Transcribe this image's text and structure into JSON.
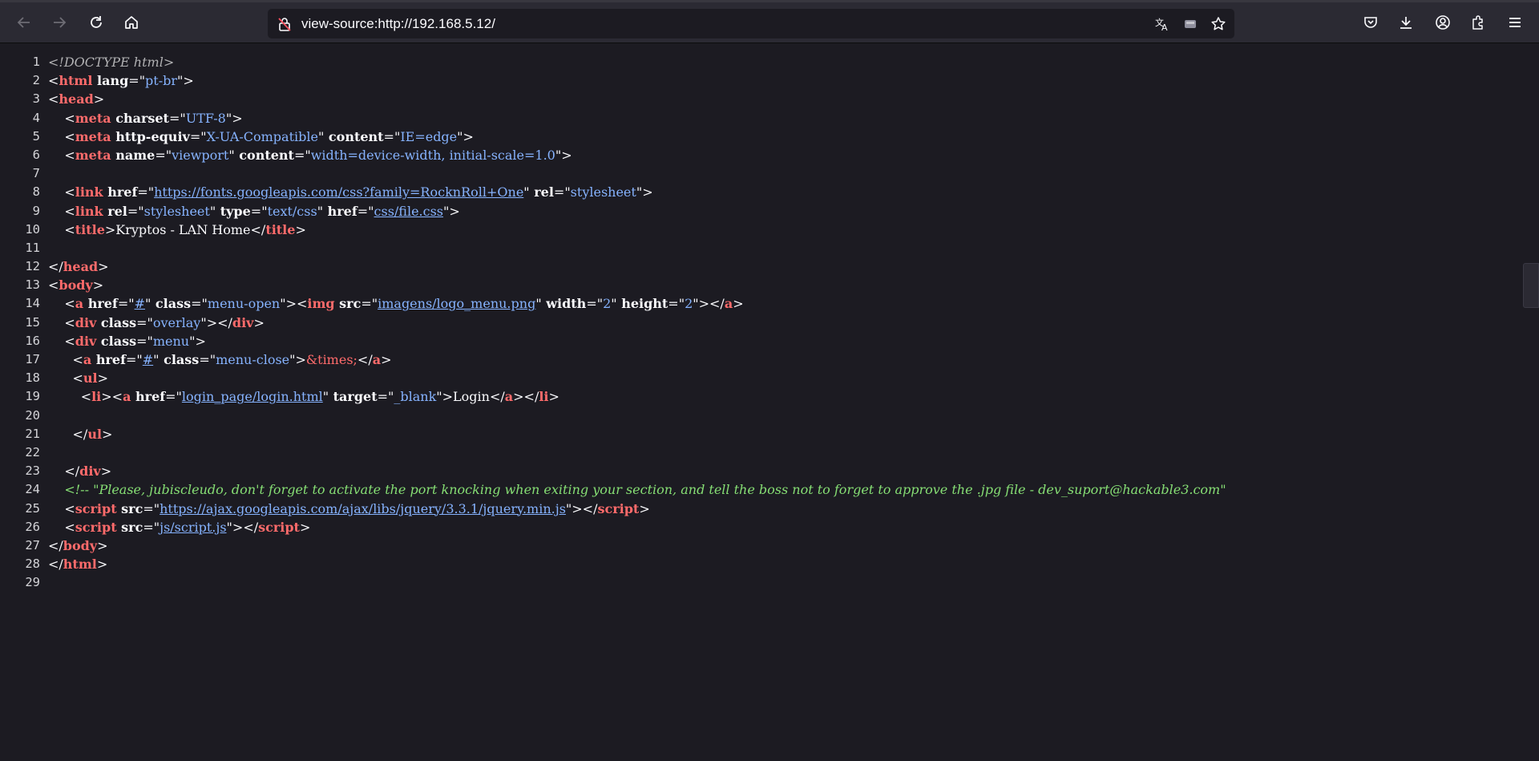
{
  "browser": {
    "url": "view-source:http://192.168.5.12/",
    "icons": [
      "back-icon",
      "forward-icon",
      "reload-icon",
      "home-icon",
      "not-secure-lock-icon",
      "translate-icon",
      "reader-icon",
      "bookmark-star-icon",
      "pocket-icon",
      "downloads-icon",
      "account-icon",
      "extensions-icon",
      "menu-icon"
    ]
  },
  "colors": {
    "background": "#1c1b22",
    "toolbar": "#2b2a33",
    "tag": "#ff6b6b",
    "attribute_value": "#86b3ff",
    "comment": "#86de74"
  },
  "source_lines": [
    {
      "n": "1",
      "segments": [
        {
          "c": "doctype",
          "t": "<!DOCTYPE html>"
        }
      ]
    },
    {
      "n": "2",
      "segments": [
        {
          "c": "br",
          "t": "<"
        },
        {
          "c": "tagname",
          "t": "html"
        },
        {
          "c": "attr",
          "t": " lang"
        },
        {
          "c": "br",
          "t": "=\""
        },
        {
          "c": "val",
          "t": "pt-br"
        },
        {
          "c": "br",
          "t": "\">"
        }
      ]
    },
    {
      "n": "3",
      "segments": [
        {
          "c": "br",
          "t": "<"
        },
        {
          "c": "tagname",
          "t": "head"
        },
        {
          "c": "br",
          "t": ">"
        }
      ]
    },
    {
      "n": "4",
      "segments": [
        {
          "c": "txt",
          "t": "    "
        },
        {
          "c": "br",
          "t": "<"
        },
        {
          "c": "tagname",
          "t": "meta"
        },
        {
          "c": "attr",
          "t": " charset"
        },
        {
          "c": "br",
          "t": "=\""
        },
        {
          "c": "val",
          "t": "UTF-8"
        },
        {
          "c": "br",
          "t": "\">"
        }
      ]
    },
    {
      "n": "5",
      "segments": [
        {
          "c": "txt",
          "t": "    "
        },
        {
          "c": "br",
          "t": "<"
        },
        {
          "c": "tagname",
          "t": "meta"
        },
        {
          "c": "attr",
          "t": " http-equiv"
        },
        {
          "c": "br",
          "t": "=\""
        },
        {
          "c": "val",
          "t": "X-UA-Compatible"
        },
        {
          "c": "br",
          "t": "\""
        },
        {
          "c": "attr",
          "t": " content"
        },
        {
          "c": "br",
          "t": "=\""
        },
        {
          "c": "val",
          "t": "IE=edge"
        },
        {
          "c": "br",
          "t": "\">"
        }
      ]
    },
    {
      "n": "6",
      "segments": [
        {
          "c": "txt",
          "t": "    "
        },
        {
          "c": "br",
          "t": "<"
        },
        {
          "c": "tagname",
          "t": "meta"
        },
        {
          "c": "attr",
          "t": " name"
        },
        {
          "c": "br",
          "t": "=\""
        },
        {
          "c": "val",
          "t": "viewport"
        },
        {
          "c": "br",
          "t": "\""
        },
        {
          "c": "attr",
          "t": " content"
        },
        {
          "c": "br",
          "t": "=\""
        },
        {
          "c": "val",
          "t": "width=device-width, initial-scale=1.0"
        },
        {
          "c": "br",
          "t": "\">"
        }
      ]
    },
    {
      "n": "7",
      "segments": []
    },
    {
      "n": "8",
      "segments": [
        {
          "c": "txt",
          "t": "    "
        },
        {
          "c": "br",
          "t": "<"
        },
        {
          "c": "tagname",
          "t": "link"
        },
        {
          "c": "attr",
          "t": " href"
        },
        {
          "c": "br",
          "t": "=\""
        },
        {
          "c": "link",
          "t": "https://fonts.googleapis.com/css?family=RocknRoll+One"
        },
        {
          "c": "br",
          "t": "\""
        },
        {
          "c": "attr",
          "t": " rel"
        },
        {
          "c": "br",
          "t": "=\""
        },
        {
          "c": "val",
          "t": "stylesheet"
        },
        {
          "c": "br",
          "t": "\">"
        }
      ]
    },
    {
      "n": "9",
      "segments": [
        {
          "c": "txt",
          "t": "    "
        },
        {
          "c": "br",
          "t": "<"
        },
        {
          "c": "tagname",
          "t": "link"
        },
        {
          "c": "attr",
          "t": " rel"
        },
        {
          "c": "br",
          "t": "=\""
        },
        {
          "c": "val",
          "t": "stylesheet"
        },
        {
          "c": "br",
          "t": "\""
        },
        {
          "c": "attr",
          "t": " type"
        },
        {
          "c": "br",
          "t": "=\""
        },
        {
          "c": "val",
          "t": "text/css"
        },
        {
          "c": "br",
          "t": "\""
        },
        {
          "c": "attr",
          "t": " href"
        },
        {
          "c": "br",
          "t": "=\""
        },
        {
          "c": "link",
          "t": "css/file.css"
        },
        {
          "c": "br",
          "t": "\">"
        }
      ]
    },
    {
      "n": "10",
      "segments": [
        {
          "c": "txt",
          "t": "    "
        },
        {
          "c": "br",
          "t": "<"
        },
        {
          "c": "tagname",
          "t": "title"
        },
        {
          "c": "br",
          "t": ">"
        },
        {
          "c": "txt",
          "t": "Kryptos - LAN Home"
        },
        {
          "c": "br",
          "t": "</"
        },
        {
          "c": "tagname",
          "t": "title"
        },
        {
          "c": "br",
          "t": ">"
        }
      ]
    },
    {
      "n": "11",
      "segments": []
    },
    {
      "n": "12",
      "segments": [
        {
          "c": "br",
          "t": "</"
        },
        {
          "c": "tagname",
          "t": "head"
        },
        {
          "c": "br",
          "t": ">"
        }
      ]
    },
    {
      "n": "13",
      "segments": [
        {
          "c": "br",
          "t": "<"
        },
        {
          "c": "tagname",
          "t": "body"
        },
        {
          "c": "br",
          "t": ">"
        }
      ]
    },
    {
      "n": "14",
      "segments": [
        {
          "c": "txt",
          "t": "    "
        },
        {
          "c": "br",
          "t": "<"
        },
        {
          "c": "tagname",
          "t": "a"
        },
        {
          "c": "attr",
          "t": " href"
        },
        {
          "c": "br",
          "t": "=\""
        },
        {
          "c": "link",
          "t": "#"
        },
        {
          "c": "br",
          "t": "\""
        },
        {
          "c": "attr",
          "t": " class"
        },
        {
          "c": "br",
          "t": "=\""
        },
        {
          "c": "val",
          "t": "menu-open"
        },
        {
          "c": "br",
          "t": "\"><"
        },
        {
          "c": "tagname",
          "t": "img"
        },
        {
          "c": "attr",
          "t": " src"
        },
        {
          "c": "br",
          "t": "=\""
        },
        {
          "c": "link",
          "t": "imagens/logo_menu.png"
        },
        {
          "c": "br",
          "t": "\""
        },
        {
          "c": "attr",
          "t": " width"
        },
        {
          "c": "br",
          "t": "=\""
        },
        {
          "c": "val",
          "t": "2"
        },
        {
          "c": "br",
          "t": "\""
        },
        {
          "c": "attr",
          "t": " height"
        },
        {
          "c": "br",
          "t": "=\""
        },
        {
          "c": "val",
          "t": "2"
        },
        {
          "c": "br",
          "t": "\"></"
        },
        {
          "c": "tagname",
          "t": "a"
        },
        {
          "c": "br",
          "t": ">"
        }
      ]
    },
    {
      "n": "15",
      "segments": [
        {
          "c": "txt",
          "t": "    "
        },
        {
          "c": "br",
          "t": "<"
        },
        {
          "c": "tagname",
          "t": "div"
        },
        {
          "c": "attr",
          "t": " class"
        },
        {
          "c": "br",
          "t": "=\""
        },
        {
          "c": "val",
          "t": "overlay"
        },
        {
          "c": "br",
          "t": "\"></"
        },
        {
          "c": "tagname",
          "t": "div"
        },
        {
          "c": "br",
          "t": ">"
        }
      ]
    },
    {
      "n": "16",
      "segments": [
        {
          "c": "txt",
          "t": "    "
        },
        {
          "c": "br",
          "t": "<"
        },
        {
          "c": "tagname",
          "t": "div"
        },
        {
          "c": "attr",
          "t": " class"
        },
        {
          "c": "br",
          "t": "=\""
        },
        {
          "c": "val",
          "t": "menu"
        },
        {
          "c": "br",
          "t": "\">"
        }
      ]
    },
    {
      "n": "17",
      "segments": [
        {
          "c": "txt",
          "t": "      "
        },
        {
          "c": "br",
          "t": "<"
        },
        {
          "c": "tagname",
          "t": "a"
        },
        {
          "c": "attr",
          "t": " href"
        },
        {
          "c": "br",
          "t": "=\""
        },
        {
          "c": "link",
          "t": "#"
        },
        {
          "c": "br",
          "t": "\""
        },
        {
          "c": "attr",
          "t": " class"
        },
        {
          "c": "br",
          "t": "=\""
        },
        {
          "c": "val",
          "t": "menu-close"
        },
        {
          "c": "br",
          "t": "\">"
        },
        {
          "c": "ent",
          "t": "&times;"
        },
        {
          "c": "br",
          "t": "</"
        },
        {
          "c": "tagname",
          "t": "a"
        },
        {
          "c": "br",
          "t": ">"
        }
      ]
    },
    {
      "n": "18",
      "segments": [
        {
          "c": "txt",
          "t": "      "
        },
        {
          "c": "br",
          "t": "<"
        },
        {
          "c": "tagname",
          "t": "ul"
        },
        {
          "c": "br",
          "t": ">"
        }
      ]
    },
    {
      "n": "19",
      "segments": [
        {
          "c": "txt",
          "t": "        "
        },
        {
          "c": "br",
          "t": "<"
        },
        {
          "c": "tagname",
          "t": "li"
        },
        {
          "c": "br",
          "t": "><"
        },
        {
          "c": "tagname",
          "t": "a"
        },
        {
          "c": "attr",
          "t": " href"
        },
        {
          "c": "br",
          "t": "=\""
        },
        {
          "c": "link",
          "t": "login_page/login.html"
        },
        {
          "c": "br",
          "t": "\""
        },
        {
          "c": "attr",
          "t": " target"
        },
        {
          "c": "br",
          "t": "=\""
        },
        {
          "c": "val",
          "t": "_blank"
        },
        {
          "c": "br",
          "t": "\">"
        },
        {
          "c": "txt",
          "t": "Login"
        },
        {
          "c": "br",
          "t": "</"
        },
        {
          "c": "tagname",
          "t": "a"
        },
        {
          "c": "br",
          "t": "></"
        },
        {
          "c": "tagname",
          "t": "li"
        },
        {
          "c": "br",
          "t": ">"
        }
      ]
    },
    {
      "n": "20",
      "segments": []
    },
    {
      "n": "21",
      "segments": [
        {
          "c": "txt",
          "t": "      "
        },
        {
          "c": "br",
          "t": "</"
        },
        {
          "c": "tagname",
          "t": "ul"
        },
        {
          "c": "br",
          "t": ">"
        }
      ]
    },
    {
      "n": "22",
      "segments": []
    },
    {
      "n": "23",
      "segments": [
        {
          "c": "txt",
          "t": "    "
        },
        {
          "c": "br",
          "t": "</"
        },
        {
          "c": "tagname",
          "t": "div"
        },
        {
          "c": "br",
          "t": ">"
        }
      ]
    },
    {
      "n": "24",
      "segments": [
        {
          "c": "txt",
          "t": "    "
        },
        {
          "c": "cmt",
          "t": "<!-- \"Please, jubiscleudo, don't forget to activate the port knocking when exiting your section, and tell the boss not to forget to approve the .jpg file - dev_suport@hackable3.com\""
        }
      ]
    },
    {
      "n": "25",
      "segments": [
        {
          "c": "txt",
          "t": "    "
        },
        {
          "c": "br",
          "t": "<"
        },
        {
          "c": "tagname",
          "t": "script"
        },
        {
          "c": "attr",
          "t": " src"
        },
        {
          "c": "br",
          "t": "=\""
        },
        {
          "c": "link",
          "t": "https://ajax.googleapis.com/ajax/libs/jquery/3.3.1/jquery.min.js"
        },
        {
          "c": "br",
          "t": "\"></"
        },
        {
          "c": "tagname",
          "t": "script"
        },
        {
          "c": "br",
          "t": ">"
        }
      ]
    },
    {
      "n": "26",
      "segments": [
        {
          "c": "txt",
          "t": "    "
        },
        {
          "c": "br",
          "t": "<"
        },
        {
          "c": "tagname",
          "t": "script"
        },
        {
          "c": "attr",
          "t": " src"
        },
        {
          "c": "br",
          "t": "=\""
        },
        {
          "c": "link",
          "t": "js/script.js"
        },
        {
          "c": "br",
          "t": "\"></"
        },
        {
          "c": "tagname",
          "t": "script"
        },
        {
          "c": "br",
          "t": ">"
        }
      ]
    },
    {
      "n": "27",
      "segments": [
        {
          "c": "br",
          "t": "</"
        },
        {
          "c": "tagname",
          "t": "body"
        },
        {
          "c": "br",
          "t": ">"
        }
      ]
    },
    {
      "n": "28",
      "segments": [
        {
          "c": "br",
          "t": "</"
        },
        {
          "c": "tagname",
          "t": "html"
        },
        {
          "c": "br",
          "t": ">"
        }
      ]
    },
    {
      "n": "29",
      "segments": []
    }
  ]
}
